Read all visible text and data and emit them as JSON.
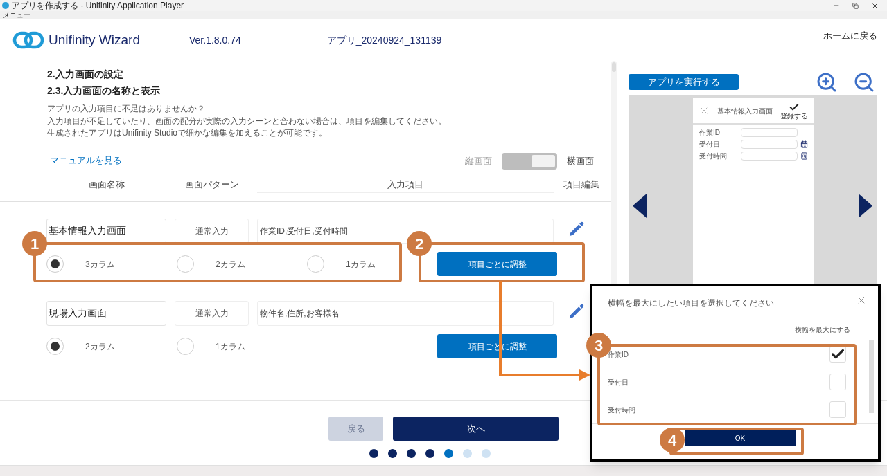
{
  "window": {
    "title": "アプリを作成する - Unifinity Application Player",
    "menu": "メニュー"
  },
  "header": {
    "brand": "Unifinity Wizard",
    "version": "Ver.1.8.0.74",
    "app_name": "アプリ_20240924_131139",
    "home_link": "ホームに戻る"
  },
  "wizard": {
    "section_title": "2.入力画面の設定",
    "subsection_title": "2.3.入力画面の名称と表示",
    "description": [
      "アプリの入力項目に不足はありませんか？",
      "入力項目が不足していたり、画面の配分が実際の入力シーンと合わない場合は、項目を編集してください。",
      "生成されたアプリはUnifinity Studioで細かな編集を加えることが可能です。"
    ],
    "manual_link": "マニュアルを見る",
    "orientation": {
      "portrait_label": "縦画面",
      "landscape_label": "横画面",
      "landscape": true
    },
    "columns": [
      "画面名称",
      "画面パターン",
      "入力項目",
      "項目編集"
    ],
    "screens": [
      {
        "name": "基本情報入力画面",
        "pattern": "通常入力",
        "items": "作業ID,受付日,受付時間",
        "adjust_button": "項目ごとに調整",
        "layouts": [
          {
            "label": "3カラム",
            "selected": true
          },
          {
            "label": "2カラム",
            "selected": false
          },
          {
            "label": "1カラム",
            "selected": false
          }
        ]
      },
      {
        "name": "現場入力画面",
        "pattern": "通常入力",
        "items": "物件名,住所,お客様名",
        "adjust_button": "項目ごとに調整",
        "layouts": [
          {
            "label": "2カラム",
            "selected": true
          },
          {
            "label": "1カラム",
            "selected": false
          }
        ]
      }
    ]
  },
  "nav": {
    "back": {
      "label": "戻る",
      "disabled": true
    },
    "next": {
      "label": "次へ"
    },
    "steps": [
      {
        "done": true,
        "selected": false
      },
      {
        "done": true,
        "selected": false
      },
      {
        "done": true,
        "selected": false
      },
      {
        "done": true,
        "selected": false
      },
      {
        "done": false,
        "selected": true
      },
      {
        "done": false,
        "selected": false
      },
      {
        "done": false,
        "selected": false
      }
    ]
  },
  "preview": {
    "run_button": "アプリを実行する",
    "phone": {
      "title": "基本情報入力画面",
      "confirm_label": "登録する",
      "fields": [
        {
          "label": "作業ID",
          "kind": "text"
        },
        {
          "label": "受付日",
          "kind": "date"
        },
        {
          "label": "受付時間",
          "kind": "time"
        }
      ]
    }
  },
  "dialog": {
    "title": "横幅を最大にしたい項目を選択してください",
    "column_header": "横幅を最大にする",
    "rows": [
      {
        "label": "作業ID",
        "checked": true
      },
      {
        "label": "受付日",
        "checked": false
      },
      {
        "label": "受付時間",
        "checked": false
      }
    ],
    "ok_button": "OK"
  },
  "callouts": [
    {
      "number": "1"
    },
    {
      "number": "2"
    },
    {
      "number": "3"
    },
    {
      "number": "4"
    }
  ]
}
